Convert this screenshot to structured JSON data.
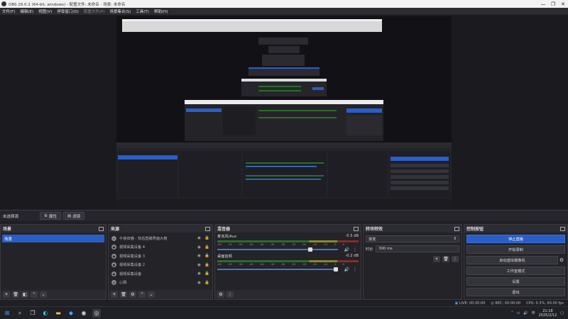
{
  "window": {
    "title": "OBS 29.0.2 (64-bit, windows) - 配置文件: 未命名 - 场景: 未命名",
    "minimize": "—",
    "maximize": "❐",
    "close": "✕"
  },
  "menu": [
    "文件(F)",
    "编辑(E)",
    "视图(V)",
    "停靠窗口(D)",
    "配置文件(P)",
    "场景集合(S)",
    "工具(T)",
    "帮助(H)"
  ],
  "scene_bar": {
    "label": "未选择源",
    "properties": "属性",
    "filters": "滤镜"
  },
  "scenes": {
    "header": "场景",
    "items": [
      "场景"
    ]
  },
  "sources": {
    "header": "来源",
    "items": [
      {
        "name": "午夜旧猫 - 背后直播界面大榕",
        "icon": "monitor-icon"
      },
      {
        "name": "视频采集设备 4",
        "icon": "camera-icon"
      },
      {
        "name": "视频采集设备 3",
        "icon": "camera-icon"
      },
      {
        "name": "视频采集设备 2",
        "icon": "camera-icon"
      },
      {
        "name": "视频采集设备",
        "icon": "camera-icon"
      },
      {
        "name": "心跳",
        "icon": "globe-icon"
      }
    ]
  },
  "mixer": {
    "header": "混音器",
    "channels": [
      {
        "name": "麦克风/Aux",
        "db": "-5.5 dB",
        "level": 0.77
      },
      {
        "name": "桌面音频",
        "db": "-0.2 dB",
        "level": 0.98
      }
    ],
    "ticks": [
      "-60",
      "-55",
      "-50",
      "-45",
      "-40",
      "-35",
      "-30",
      "-25",
      "-20",
      "-15",
      "-10",
      "-5",
      "0"
    ]
  },
  "transitions": {
    "header": "转场特效",
    "selected": "渐变",
    "duration_label": "时长",
    "duration_value": "300 ms"
  },
  "controls": {
    "header": "控制按钮",
    "stop_stream": "停止直播",
    "start_record": "开始录制",
    "virtual_cam": "启动虚拟摄像机",
    "studio_mode": "工作室模式",
    "settings": "设置",
    "exit": "退出"
  },
  "status": {
    "live": "LIVE: 00:00:00",
    "rec": "REC: 00:00:00",
    "cpu": "CPU: 0.5%, 60.00 fps"
  },
  "taskbar": {
    "ime": "中",
    "time": "21:18",
    "date": "2025/2/12"
  },
  "colors": {
    "accent": "#2a5ec7",
    "background": "#1e1e24",
    "panel": "#232328"
  }
}
